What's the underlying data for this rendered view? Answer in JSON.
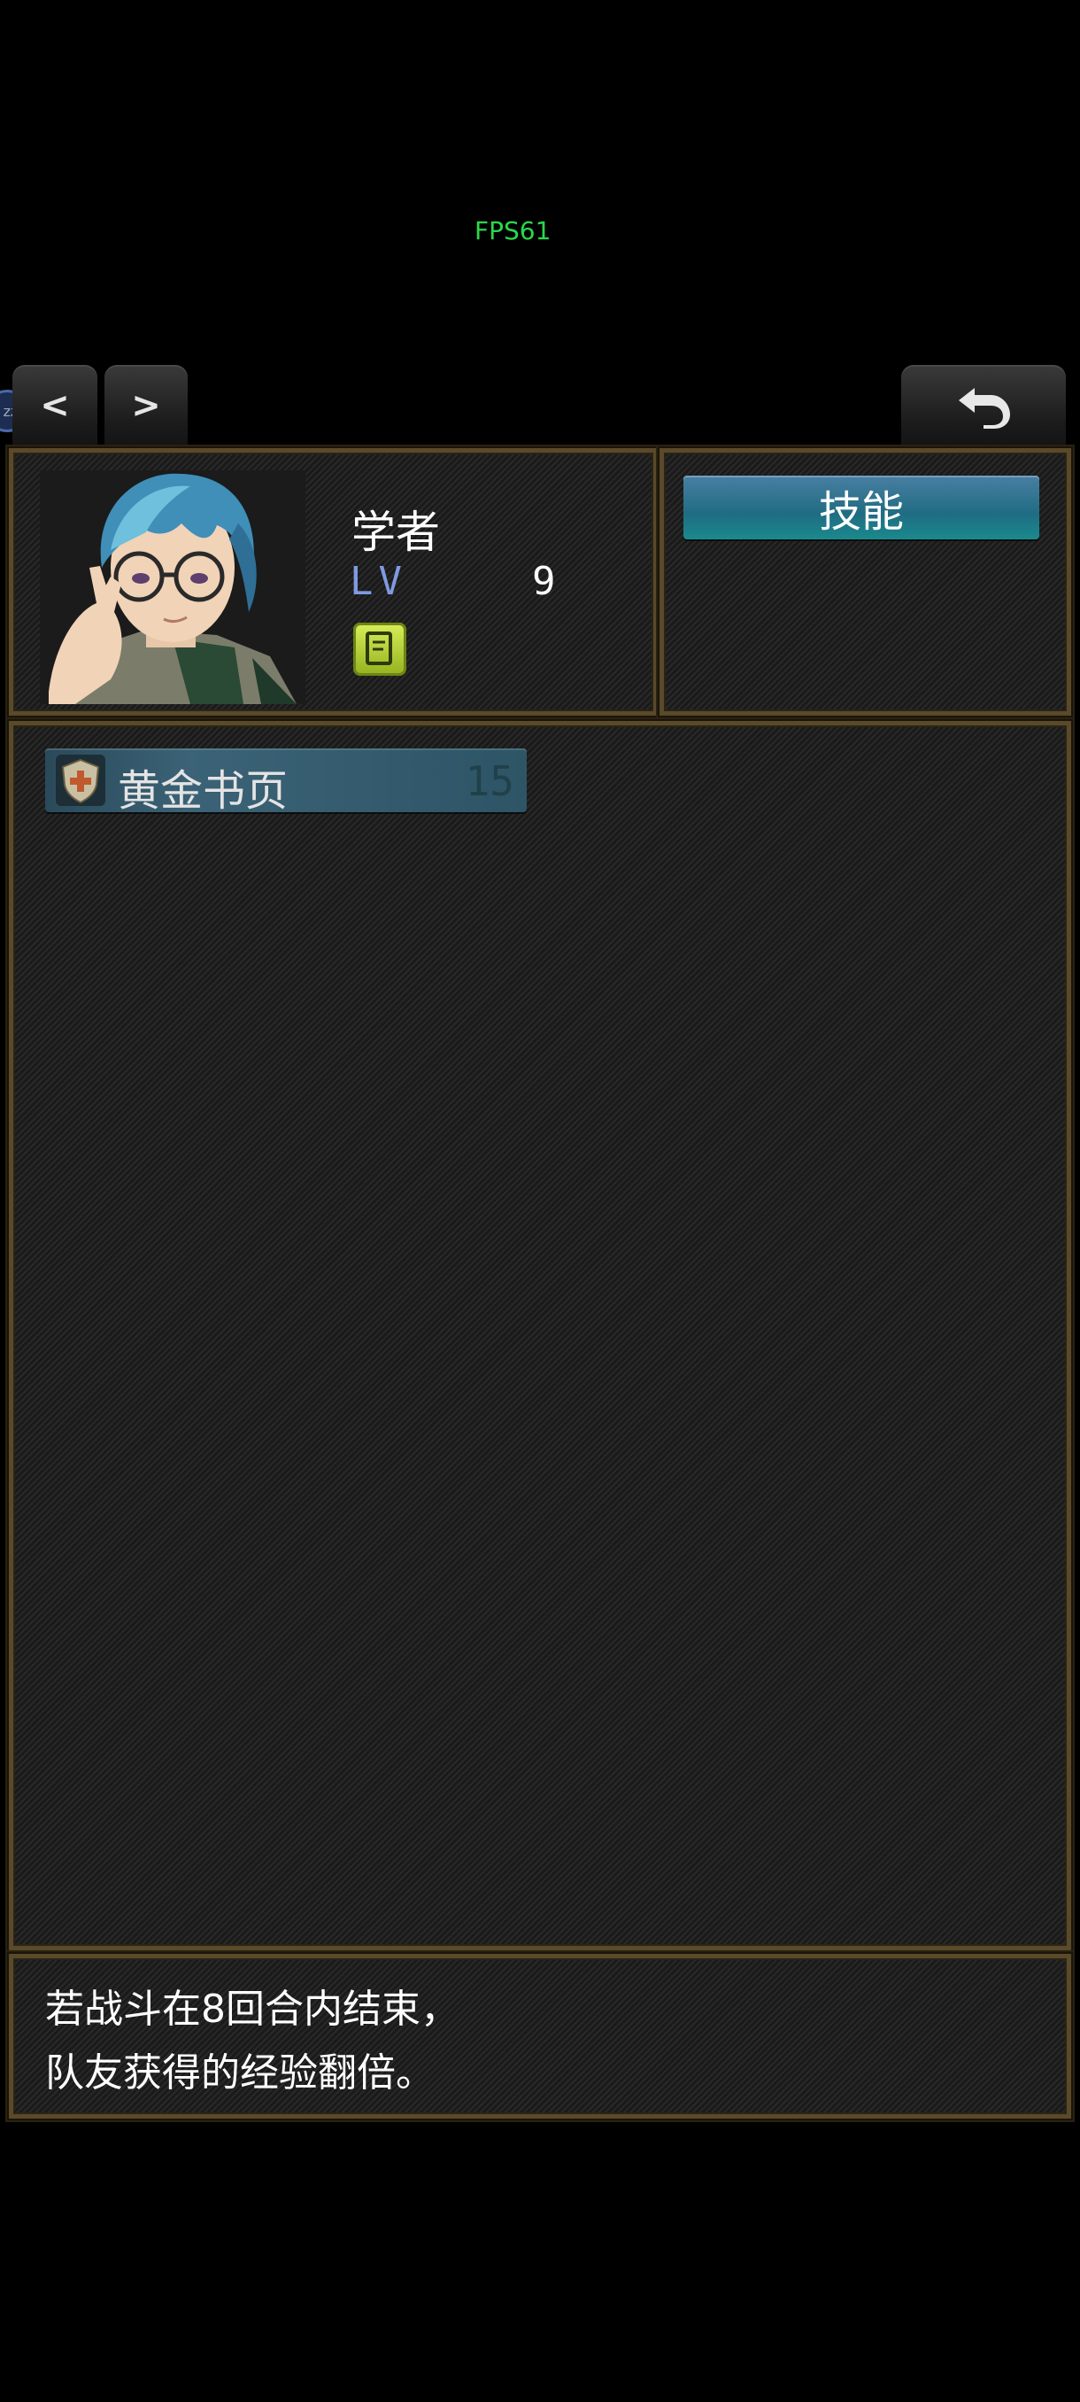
{
  "hud": {
    "fps": "FPS61"
  },
  "nav": {
    "prev_label": "<",
    "next_label": ">",
    "back_icon": "return-arrow-icon",
    "zz_badge": "zz"
  },
  "character": {
    "class_name": "学者",
    "lv_label": "LV",
    "lv_value": "9",
    "portrait": "scholar-portrait",
    "item_icon": "book-icon"
  },
  "skills_panel": {
    "tab_label": "技能"
  },
  "skill_list": [
    {
      "name": "黄金书页",
      "cost": "15",
      "icon": "shield-cross-icon"
    }
  ],
  "description": {
    "line1": "若战斗在8回合内结束，",
    "line2": "队友获得的经验翻倍。"
  },
  "colors": {
    "frame": "#5a4a2a",
    "skill_button": "#1f6c82",
    "fps_green": "#2bd94a",
    "lv_blue": "#7f9ae0"
  }
}
